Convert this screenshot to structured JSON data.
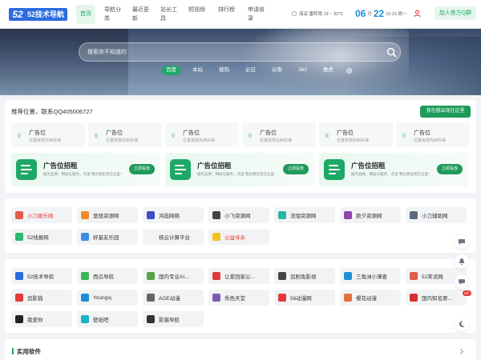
{
  "header": {
    "logo_badge": "52",
    "logo_text": "52技术导航",
    "nav": [
      "首页",
      "导航分类",
      "最近更新",
      "站长工具",
      "短视频",
      "排行榜",
      "申请收录"
    ],
    "weather": "海淀 雷阵雨 19 ~ 32℃",
    "date": {
      "month": "06",
      "sep": "月",
      "day": "22",
      "time": "16:10 周一"
    },
    "qq_button": "加入官方Q群"
  },
  "search": {
    "placeholder": "搜索你不知道的",
    "engines": [
      "百度",
      "本站",
      "搜狗",
      "必应",
      "谷歌",
      "360",
      "推虎"
    ],
    "active_engine": "百度"
  },
  "ads": {
    "title": "推荐位置，联系QQ405006727",
    "button": "我也想出现在这里",
    "slots": [
      {
        "title": "广告位",
        "desc": "位置有限先到先得"
      },
      {
        "title": "广告位",
        "desc": "位置有限先到先得"
      },
      {
        "title": "广告位",
        "desc": "位置有限先到先得"
      },
      {
        "title": "广告位",
        "desc": "位置有限先到先得"
      },
      {
        "title": "广告位",
        "desc": "位置有限先到先得"
      },
      {
        "title": "广告位",
        "desc": "位置有限先到先得"
      }
    ],
    "rent": [
      {
        "title": "广告位招租",
        "desc": "展示品牌，网站与服务，点击“我也想出现在这里”",
        "button": "立即投放"
      },
      {
        "title": "广告位招租",
        "desc": "展示品牌，网站与服务，点击“我也想出现在这里”",
        "button": "立即投放"
      },
      {
        "title": "广告位招租",
        "desc": "展示品牌，网站与服务，点击“我也想出现在这里”",
        "button": "立即投放"
      }
    ]
  },
  "sites1": [
    {
      "label": "小刀娱乐网",
      "color": "#e25b4b",
      "hot": true
    },
    {
      "label": "悠悠资源网",
      "color": "#f08a24"
    },
    {
      "label": "鸿茹网络",
      "color": "#3b4ec2"
    },
    {
      "label": "小飞资源网",
      "color": "#444444"
    },
    {
      "label": "流氓资源网",
      "color": "#2bb3a7"
    },
    {
      "label": "颜夕资源网",
      "color": "#8e44ad"
    },
    {
      "label": "小刀辅助网",
      "color": "#5b6b7d"
    },
    {
      "label": "52线报网",
      "color": "#2bb86f"
    },
    {
      "label": "好基友乐园",
      "color": "#3b8de0"
    },
    {
      "label": "核云计算平台",
      "color": "#f2f3f5"
    },
    {
      "label": "公益寻亲",
      "color": "#f0c224",
      "hot": true
    }
  ],
  "sites2": [
    {
      "label": "52技术导航",
      "color": "#2b6cdf"
    },
    {
      "label": "西瓜导航",
      "color": "#3fb55a"
    },
    {
      "label": "国内专业AI...",
      "color": "#58a145"
    },
    {
      "label": "让爱回家公...",
      "color": "#e23a3a"
    },
    {
      "label": "追剧兔影视",
      "color": "#444444"
    },
    {
      "label": "三角洲小薄查",
      "color": "#1e90d7"
    },
    {
      "label": "52笑话网",
      "color": "#e25b4b"
    },
    {
      "label": "追影猫",
      "color": "#e23a3a"
    },
    {
      "label": "Youngxj",
      "color": "#1e8fd7"
    },
    {
      "label": "AGE动漫",
      "color": "#666666"
    },
    {
      "label": "秀色天堂",
      "color": "#7d5ab5"
    },
    {
      "label": "58动漫网",
      "color": "#e23a3a"
    },
    {
      "label": "樱花动漫",
      "color": "#e2733a"
    },
    {
      "label": "国内知名原...",
      "color": "#d63030"
    },
    {
      "label": "我爱你",
      "color": "#222222"
    },
    {
      "label": "壁纸吧",
      "color": "#1eb0c8"
    },
    {
      "label": "影猫导航",
      "color": "#333333"
    }
  ],
  "section": {
    "title": "实用软件"
  },
  "float": {
    "badge": "26°"
  },
  "colors": {
    "accent": "#1ea865",
    "brand": "#2b6cdf"
  }
}
